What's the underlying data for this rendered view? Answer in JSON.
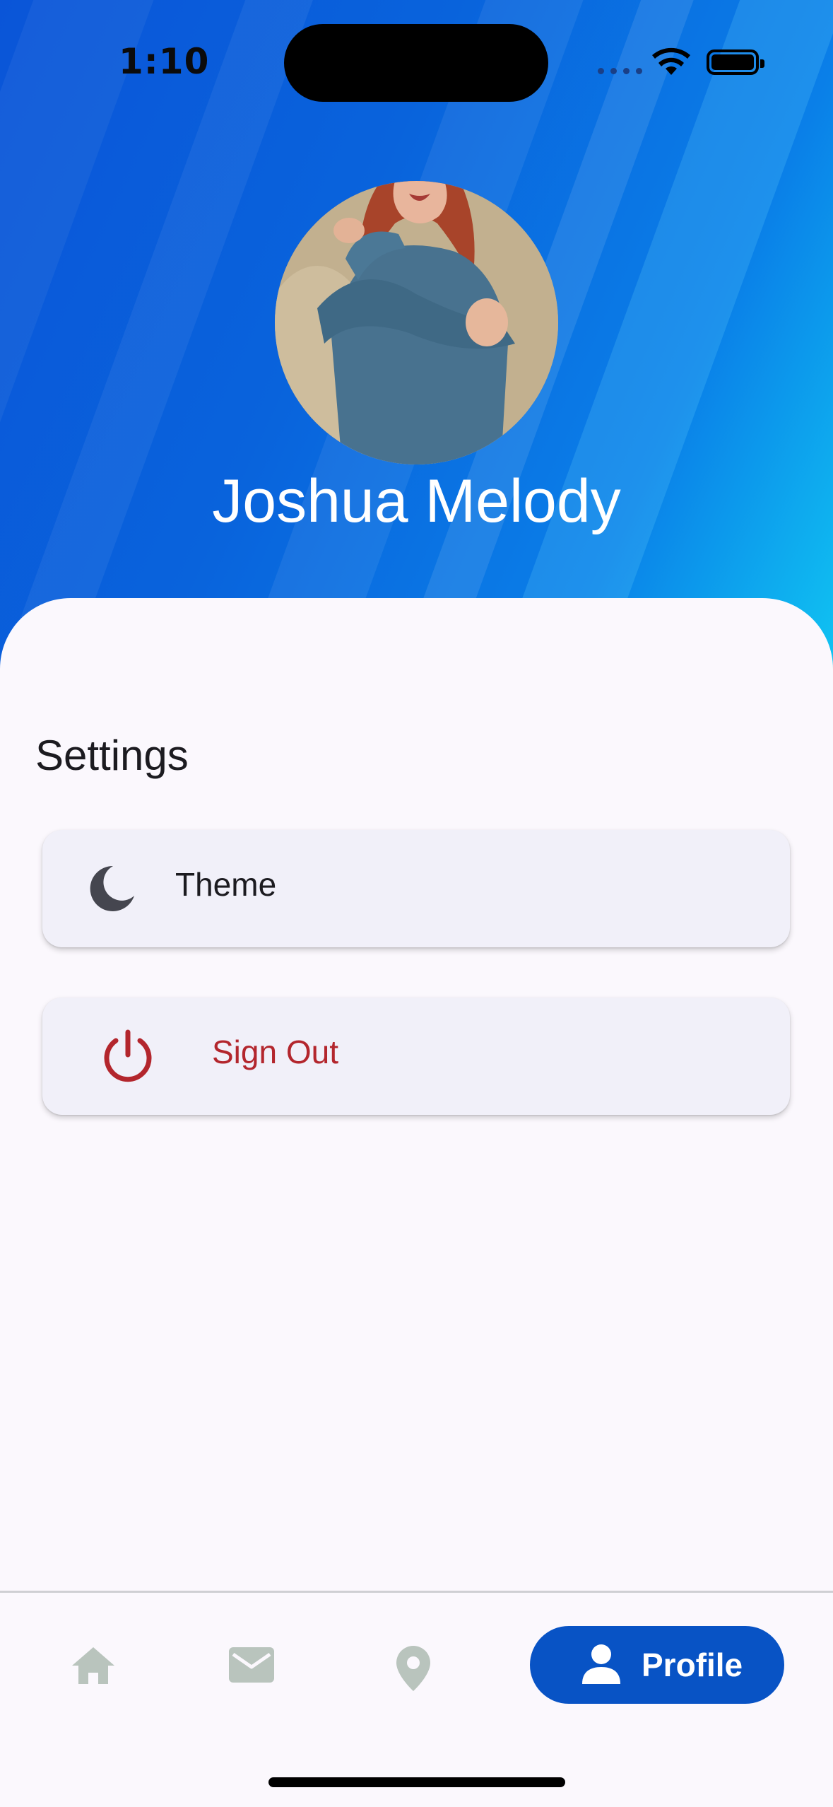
{
  "status_bar": {
    "time": "1:10"
  },
  "profile": {
    "name": "Joshua Melody"
  },
  "settings": {
    "title": "Settings",
    "items": [
      {
        "label": "Theme",
        "icon": "moon-icon"
      },
      {
        "label": "Sign Out",
        "icon": "power-icon",
        "color": "#b3262d"
      }
    ]
  },
  "bottom_nav": {
    "items": [
      {
        "icon": "home-icon"
      },
      {
        "icon": "mail-icon"
      },
      {
        "icon": "location-pin-icon"
      },
      {
        "icon": "person-icon",
        "label": "Profile",
        "active": true
      }
    ]
  },
  "colors": {
    "accent": "#0853c5",
    "danger": "#b3262d",
    "inactive_icon": "#b9c4bd"
  }
}
